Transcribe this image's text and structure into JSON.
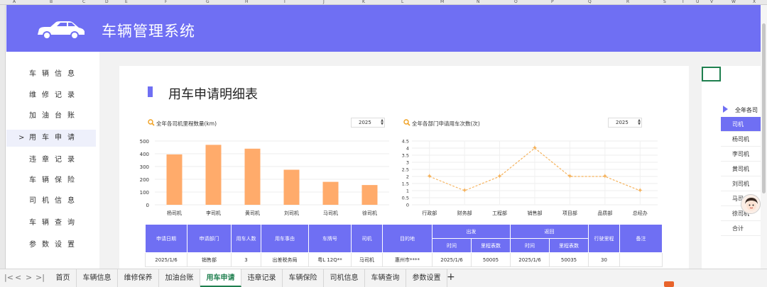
{
  "column_headers": [
    "A",
    "B",
    "C",
    "D",
    "E",
    "F",
    "G",
    "H",
    "I",
    "J",
    "K",
    "L",
    "M",
    "N",
    "O",
    "P",
    "Q",
    "R",
    "S",
    "T",
    "U",
    "V",
    "W",
    "X"
  ],
  "app": {
    "title": "车辆管理系统"
  },
  "sidebar": {
    "items": [
      {
        "label": "车辆信息"
      },
      {
        "label": "维修记录"
      },
      {
        "label": "加油台账"
      },
      {
        "label": "用车申请",
        "active": true,
        "caret": ">"
      },
      {
        "label": "违章记录"
      },
      {
        "label": "车辆保险"
      },
      {
        "label": "司机信息"
      },
      {
        "label": "车辆查询"
      },
      {
        "label": "参数设置"
      }
    ]
  },
  "page": {
    "title": "用车申请明细表"
  },
  "chart_data": [
    {
      "type": "bar",
      "title": "全年各司机里程数量(km)",
      "year": "2025",
      "categories": [
        "杨司机",
        "李司机",
        "黄司机",
        "刘司机",
        "马司机",
        "徐司机"
      ],
      "values": [
        395,
        470,
        440,
        275,
        180,
        155
      ],
      "ylim": [
        0,
        500
      ],
      "yticks": [
        "500",
        "400",
        "300",
        "200",
        "100",
        "0"
      ],
      "color": "#ffab6b",
      "grid": true
    },
    {
      "type": "line",
      "title": "全年各部门申请用车次数(次)",
      "year": "2025",
      "categories": [
        "行政部",
        "财务部",
        "工程部",
        "销售部",
        "项目部",
        "品质部",
        "总经办"
      ],
      "values": [
        2,
        1,
        2,
        4,
        2,
        2,
        1
      ],
      "ylim": [
        0,
        4.5
      ],
      "yticks": [
        "4.5",
        "4",
        "3.5",
        "3",
        "2.5",
        "2",
        "1.5",
        "1",
        "0.5",
        "0"
      ],
      "color": "#f5b25c",
      "grid": true
    }
  ],
  "table": {
    "headers": {
      "date": "申请日期",
      "dept": "申请部门",
      "people": "用车人数",
      "reason": "用车事由",
      "plate": "车牌号",
      "driver": "司机",
      "dest": "目的地",
      "out": "出发",
      "back": "返回",
      "mileage": "行驶里程",
      "remark": "备注",
      "time": "时间",
      "odo": "里程表数"
    },
    "rows": [
      {
        "date": "2025/1/6",
        "dept": "销售部",
        "people": "3",
        "reason": "出差税务局",
        "plate": "粤L 12Q**",
        "driver": "马司机",
        "dest": "惠州市****",
        "out_time": "2025/1/6",
        "out_odo": "50005",
        "back_time": "2025/1/6",
        "back_odo": "50035",
        "mileage": "30",
        "remark": ""
      }
    ]
  },
  "right_panel": {
    "title": "全年各司",
    "items": [
      {
        "label": "司机",
        "active": true
      },
      {
        "label": "杨司机"
      },
      {
        "label": "李司机"
      },
      {
        "label": "黄司机"
      },
      {
        "label": "刘司机"
      },
      {
        "label": "马司"
      },
      {
        "label": "徐司机"
      },
      {
        "label": "合计"
      }
    ]
  },
  "tabs": {
    "nav": [
      "|<",
      "<",
      ">",
      ">|"
    ],
    "items": [
      {
        "label": "首页"
      },
      {
        "label": "车辆信息"
      },
      {
        "label": "维修保养"
      },
      {
        "label": "加油台账"
      },
      {
        "label": "用车申请",
        "active": true
      },
      {
        "label": "违章记录"
      },
      {
        "label": "车辆保险"
      },
      {
        "label": "司机信息"
      },
      {
        "label": "车辆查询"
      },
      {
        "label": "参数设置"
      }
    ],
    "add": "+"
  }
}
